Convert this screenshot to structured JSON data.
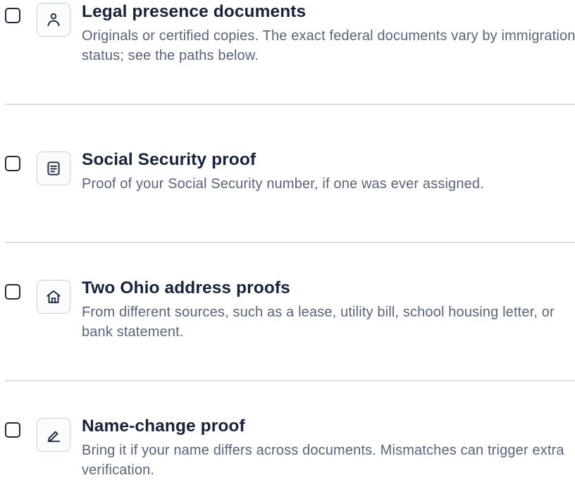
{
  "checklist": {
    "items": [
      {
        "title": "Legal presence documents",
        "description": "Originals or certified copies. The exact federal documents vary by immigration status; see the paths below.",
        "icon": "person-icon"
      },
      {
        "title": "Social Security proof",
        "description": "Proof of your Social Security number, if one was ever assigned.",
        "icon": "document-icon"
      },
      {
        "title": "Two Ohio address proofs",
        "description": "From different sources, such as a lease, utility bill, school housing letter, or bank statement.",
        "icon": "home-icon"
      },
      {
        "title": "Name-change proof",
        "description": "Bring it if your name differs across documents. Mismatches can trigger extra verification.",
        "icon": "pen-icon"
      }
    ]
  },
  "colors": {
    "title": "#15233d",
    "description": "#56647c",
    "icon_stroke": "#1e2b42",
    "icon_border": "#c3cfdf",
    "divider": "#d9dfe8"
  }
}
